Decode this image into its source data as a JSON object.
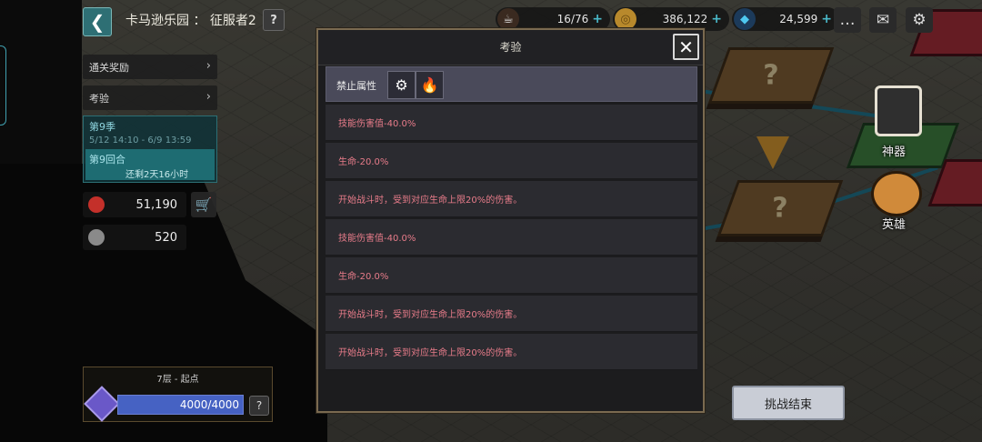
{
  "header": {
    "title": "卡马逊乐园 ： 征服者2",
    "help": "?",
    "resources": [
      {
        "name": "stamina",
        "icon": "coffee-cup-icon",
        "value": "16/76"
      },
      {
        "name": "gold",
        "icon": "gold-coin-icon",
        "value": "386,122"
      },
      {
        "name": "gems",
        "icon": "blue-gem-icon",
        "value": "24,599"
      }
    ]
  },
  "left_panel": {
    "clear_rewards": "通关奖励",
    "trial": "考验",
    "season": "第9季",
    "season_dates": "5/12 14:10 - 6/9 13:59",
    "round": "第9回合",
    "round_remaining": "还剩2天16小时",
    "currency_1": "51,190",
    "currency_2": "520",
    "floor_title": "7层 - 起点",
    "floor_progress_text": "4000/4000",
    "floor_progress_fraction": 1.0
  },
  "map": {
    "artifact_label": "神器",
    "hero_label": "英雄",
    "end_battle_label": "挑战结束"
  },
  "dialog": {
    "title": "考验",
    "close": "✕",
    "banned_label": "禁止属性",
    "banned_icons": [
      "gear-attribute-icon",
      "fire-attribute-icon"
    ],
    "rows": [
      "技能伤害值-40.0%",
      "生命-20.0%",
      "开始战斗时，受到对应生命上限20%的伤害。",
      "技能伤害值-40.0%",
      "生命-20.0%",
      "开始战斗时，受到对应生命上限20%的伤害。",
      "开始战斗时，受到对应生命上限20%的伤害。"
    ]
  },
  "colors": {
    "dialog_border": "#7a6a50",
    "effect_text": "#e87c8a",
    "accent_teal": "#2e6f74"
  }
}
